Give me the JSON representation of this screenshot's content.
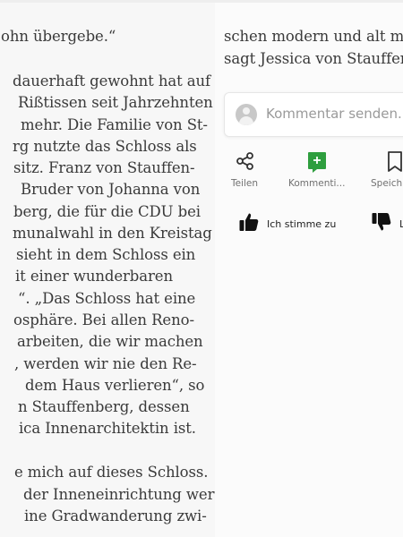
{
  "article": {
    "left_lines": [
      "ohn übergebe.“",
      "",
      "dauerhaft gewohnt hat auf",
      "Rißtissen seit Jahrzehnten",
      "mehr. Die Familie von St-",
      "rg nutzte das Schloss als",
      "sitz. Franz von Stauffen-",
      "Bruder von Johanna von",
      "berg, die für die CDU bei",
      "munalwahl in den Kreistag",
      "sieht in dem Schloss ein",
      "it einer wunderbaren",
      "“. „Das Schloss hat eine",
      "osphäre. Bei allen Reno-",
      "arbeiten, die wir machen",
      ", werden wir nie den Re-",
      "dem Haus verlieren“, so",
      "n Stauffenberg, dessen",
      "ica Innenarchitektin ist.",
      "",
      "e mich auf dieses Schloss.",
      "der Inneneinrichtung wer-",
      "ine Gradwanderung zwi-"
    ],
    "right_lines": [
      "schen modern und alt ma",
      "sagt Jessica von Stauffenb"
    ]
  },
  "comment": {
    "placeholder": "Kommentar senden..."
  },
  "actions": [
    {
      "label": "Teilen",
      "icon": "share-icon"
    },
    {
      "label": "Kommenti...",
      "icon": "comment-add-icon"
    },
    {
      "label": "Speich",
      "icon": "bookmark-icon"
    }
  ],
  "votes": {
    "agree_label": "Ich stimme zu",
    "disagree_label": "L"
  },
  "colors": {
    "accent_green": "#2e9e3e",
    "text": "#3a3a3a",
    "muted": "#707070"
  }
}
